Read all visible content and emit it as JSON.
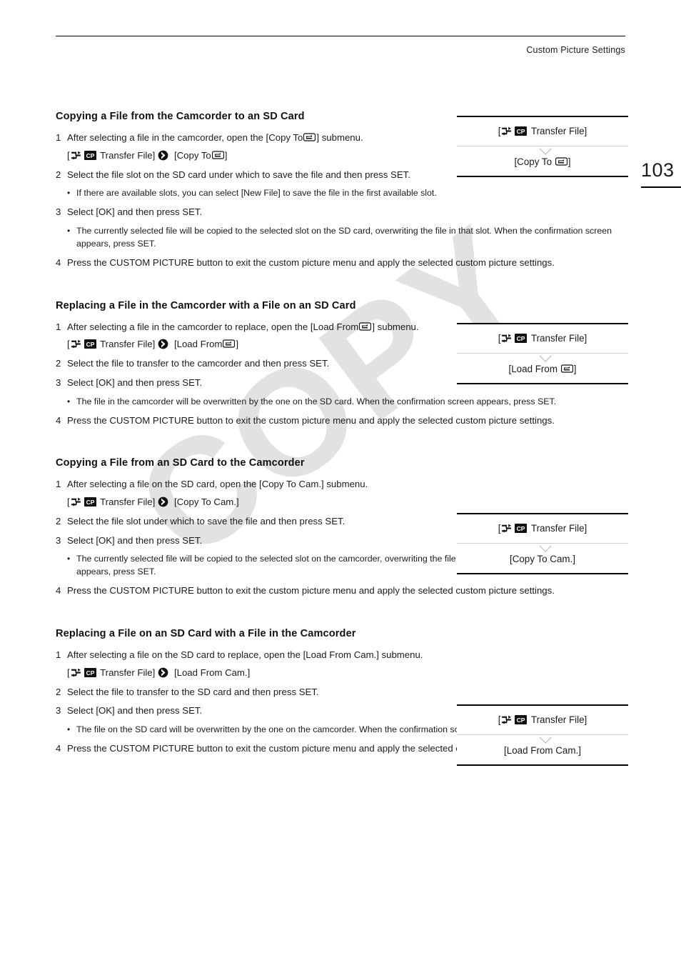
{
  "header": {
    "title": "Custom Picture Settings"
  },
  "folio": {
    "page_number": "103"
  },
  "watermark": {
    "text": "COPY"
  },
  "icons": {
    "transfer": "transfer-file-icon",
    "cp": "custom-picture-icon",
    "sd": "sd-card-icon",
    "arrow": "submenu-arrow-icon"
  },
  "menu_labels": {
    "transfer_file": "Transfer File]",
    "bracket_open": "[",
    "copy_to_sd": "[Copy To",
    "copy_to_sd_close": "]",
    "load_from_sd": "[Load From",
    "load_from_sd_close": "]",
    "copy_to_cam": "[Copy To Cam.]",
    "load_from_cam": "[Load From Cam.]"
  },
  "sections": [
    {
      "title": "Copying a File from the Camcorder to an SD Card",
      "steps": [
        {
          "num": "1",
          "text_before_icon": "After selecting a file in the camcorder, open the [Copy To",
          "text_after_icon": "] submenu.",
          "path_prefix": "[",
          "path_mid": "Transfer File]",
          "path_target_before": "[Copy To",
          "path_target_after": "]"
        },
        {
          "num": "2",
          "text": "Select the file slot on the SD card under which to save the file and then press SET."
        },
        {
          "num": "3",
          "text": "Select [OK] and then press SET."
        },
        {
          "num": "4",
          "text": "Press the CUSTOM PICTURE button to exit the custom picture menu and apply the selected custom picture settings."
        }
      ],
      "bullets": [
        "If there are available slots, you can select [New File] to save the file in the first available slot.",
        "The currently selected file will be copied to the selected slot on the SD card, overwriting the file in that slot. When the confirmation screen appears, press SET."
      ]
    },
    {
      "title": "Replacing a File in the Camcorder with a File on an SD Card",
      "steps": [
        {
          "num": "1",
          "text_before_icon": "After selecting a file in the camcorder to replace, open the [Load From",
          "text_after_icon": "] submenu.",
          "path_prefix": "[",
          "path_mid": "Transfer File]",
          "path_target_before": "[Load From",
          "path_target_after": "]"
        },
        {
          "num": "2",
          "text": "Select the file to transfer to the camcorder and then press SET."
        },
        {
          "num": "3",
          "text": "Select [OK] and then press SET."
        },
        {
          "num": "4",
          "text": "Press the CUSTOM PICTURE button to exit the custom picture menu and apply the selected custom picture settings."
        }
      ],
      "bullets": [
        "The file in the camcorder will be overwritten by the one on the SD card. When the confirmation screen appears, press SET."
      ]
    },
    {
      "title": "Copying a File from an SD Card to the Camcorder",
      "steps": [
        {
          "num": "1",
          "text_before_icon": "After selecting a file on the SD card, open the [Copy To Cam.] submenu.",
          "text_after_icon": "",
          "path_prefix": "[",
          "path_mid": "Transfer File]",
          "path_target_before": "[Copy To Cam.]",
          "path_target_after": ""
        },
        {
          "num": "2",
          "text": "Select the file slot under which to save the file and then press SET."
        },
        {
          "num": "3",
          "text": "Select [OK] and then press SET."
        },
        {
          "num": "4",
          "text": "Press the CUSTOM PICTURE button to exit the custom picture menu and apply the selected custom picture settings."
        }
      ],
      "bullets": [
        "The currently selected file will be copied to the selected slot on the camcorder, overwriting the file in that slot. When the confirmation screen appears, press SET."
      ]
    },
    {
      "title": "Replacing a File on an SD Card with a File in the Camcorder",
      "steps": [
        {
          "num": "1",
          "text_before_icon": "After selecting a file on the SD card to replace, open the [Load From Cam.] submenu.",
          "text_after_icon": "",
          "path_prefix": "[",
          "path_mid": "Transfer File]",
          "path_target_before": "[Load From Cam.]",
          "path_target_after": ""
        },
        {
          "num": "2",
          "text": "Select the file to transfer to the SD card and then press SET."
        },
        {
          "num": "3",
          "text": "Select [OK] and then press SET."
        },
        {
          "num": "4",
          "text": "Press the CUSTOM PICTURE button to exit the custom picture menu and apply the selected custom picture settings."
        }
      ],
      "bullets": [
        "The file on the SD card will be overwritten by the one on the camcorder. When the confirmation screen appears, press SET."
      ]
    }
  ],
  "callouts": [
    {
      "top_prefix": "[",
      "top_label": "Transfer File]",
      "bottom_before": "[Copy To",
      "bottom_after": "]",
      "bottom_has_sd": true
    },
    {
      "top_prefix": "[",
      "top_label": "Transfer File]",
      "bottom_before": "[Load From",
      "bottom_after": "]",
      "bottom_has_sd": true
    },
    {
      "top_prefix": "[",
      "top_label": "Transfer File]",
      "bottom_before": "[Copy To Cam.]",
      "bottom_after": "",
      "bottom_has_sd": false
    },
    {
      "top_prefix": "[",
      "top_label": "Transfer File]",
      "bottom_before": "[Load From Cam.]",
      "bottom_after": "",
      "bottom_has_sd": false
    }
  ]
}
